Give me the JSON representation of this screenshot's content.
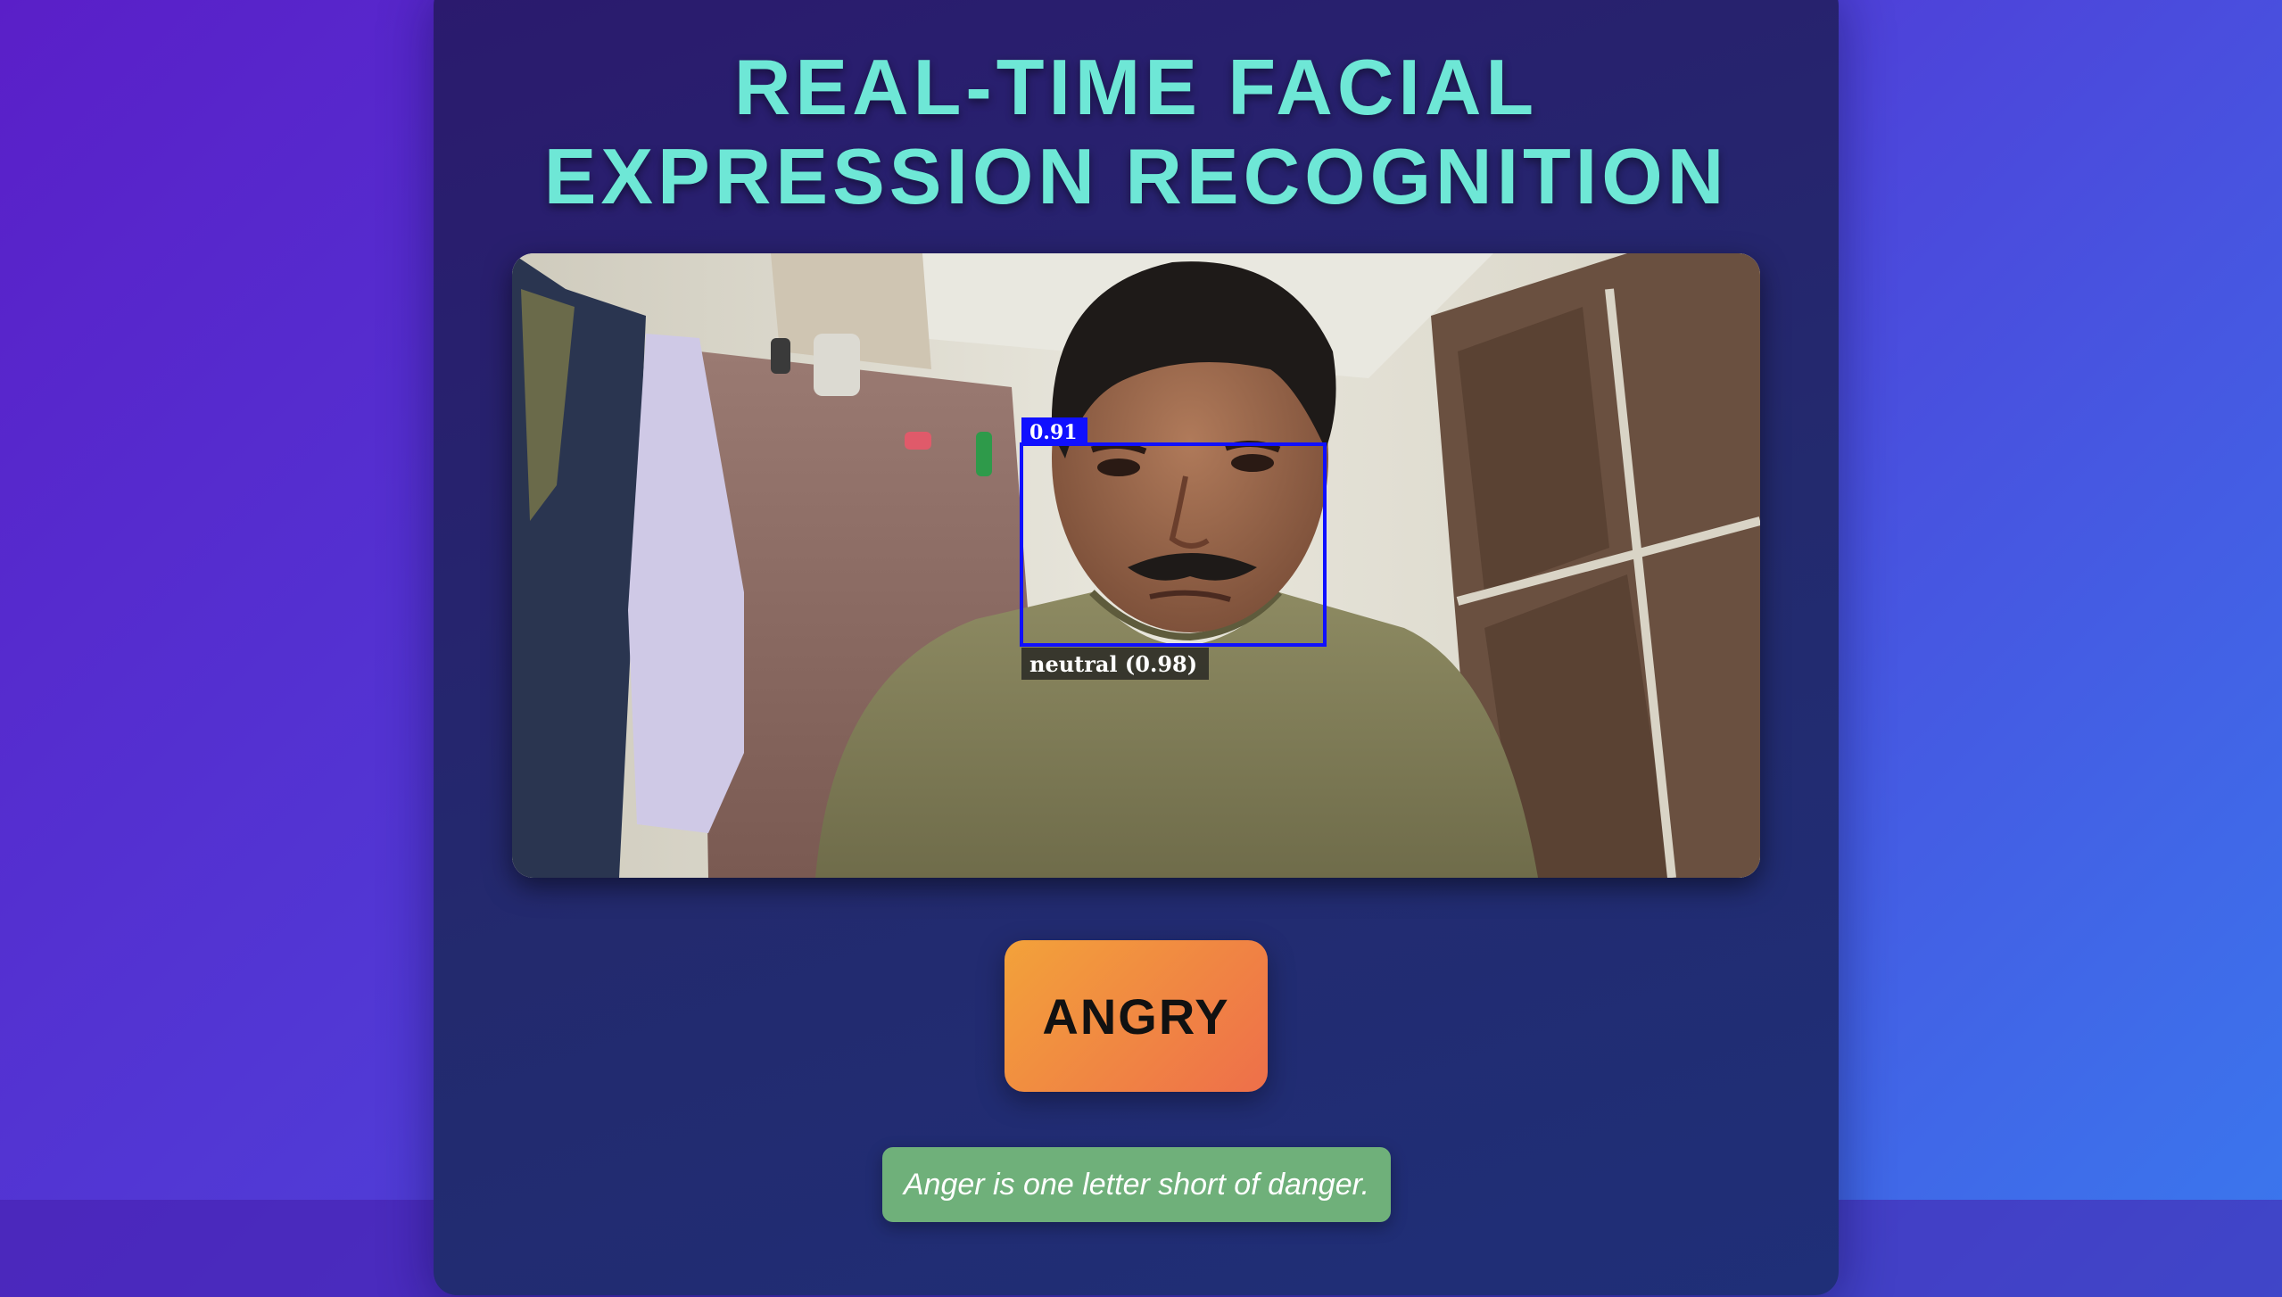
{
  "page": {
    "title": "REAL-TIME FACIAL EXPRESSION RECOGNITION",
    "title_line1": "REAL-TIME FACIAL",
    "title_line2": "EXPRESSION RECOGNITION"
  },
  "video": {
    "detection": {
      "score_label": "0.91",
      "emotion_label": "neutral (0.98)",
      "box_color": "#1010ff"
    }
  },
  "result": {
    "emotion": "ANGRY",
    "quote": "Anger is one letter short of danger."
  },
  "colors": {
    "title": "#6ee7d6",
    "badge_start": "#f3a23a",
    "badge_end": "#ee6f4a",
    "quote_bg": "#6fb07a"
  }
}
